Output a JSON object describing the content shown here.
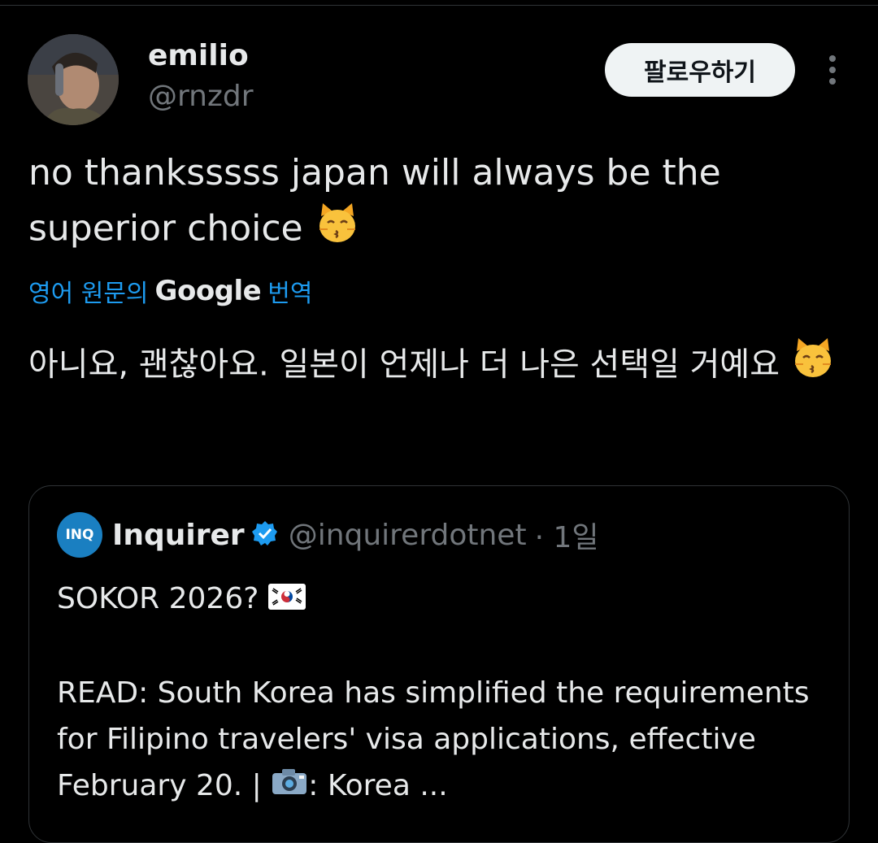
{
  "user": {
    "name": "emilio",
    "handle": "@rnzdr"
  },
  "actions": {
    "follow_label": "팔로우하기",
    "more_icon": "more-vertical-icon"
  },
  "tweet": {
    "text": "no thanksssss japan will always be the superior choice",
    "emoji": "kissing-cat-emoji"
  },
  "translation_bar": {
    "prefix": "영어 원문의",
    "brand": "Google",
    "suffix": "번역"
  },
  "translated": {
    "text": "아니요, 괜찮아요. 일본이 언제나 더 나은 선택일 거예요"
  },
  "quote": {
    "logo_text": "INQ",
    "name": "Inquirer",
    "verified_icon": "verified-badge-icon",
    "handle": "@inquirerdotnet",
    "time": "· 1일",
    "line1": "SOKOR 2026?",
    "body": "READ: South Korea has simplified the requirements for Filipino travelers' visa applications, effective February 20. |",
    "body_end": ": Korea ...",
    "flag_icon": "south-korea-flag-icon",
    "camera_icon": "camera-icon"
  },
  "colors": {
    "background": "#000000",
    "text": "#e7e9ea",
    "muted": "#71767b",
    "link": "#1d9bf0",
    "follow_bg": "#eff3f4",
    "verified": "#1d9bf0"
  }
}
